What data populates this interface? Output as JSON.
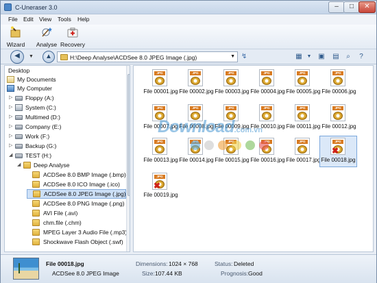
{
  "window": {
    "title": "C-Uneraser 3.0"
  },
  "menu": [
    "File",
    "Edit",
    "View",
    "Tools",
    "Help"
  ],
  "toolbar": {
    "wizard": "Wizard",
    "analyse": "Analyse",
    "recovery": "Recovery"
  },
  "address": {
    "path": "H:\\Deep Analyse\\ACDSee 8.0 JPEG Image (.jpg)"
  },
  "tree": {
    "items": [
      {
        "label": "Desktop",
        "icon": "desktop-icon"
      },
      {
        "label": "My Documents",
        "icon": "documents-icon"
      },
      {
        "label": "My Computer",
        "icon": "computer-icon"
      },
      {
        "label": "Floppy (A:)",
        "icon": "drive-icon"
      },
      {
        "label": "System (C:)",
        "icon": "system-drive-icon"
      },
      {
        "label": "Multimed (D:)",
        "icon": "drive-icon"
      },
      {
        "label": "Company (E:)",
        "icon": "drive-icon"
      },
      {
        "label": "Work (F:)",
        "icon": "drive-icon"
      },
      {
        "label": "Backup (G:)",
        "icon": "drive-icon"
      },
      {
        "label": "TEST (H:)",
        "icon": "drive-icon"
      },
      {
        "label": "Deep Analyse",
        "icon": "folder-icon"
      },
      {
        "label": "ACDSee 8.0 BMP Image (.bmp)",
        "icon": "folder-icon"
      },
      {
        "label": "ACDSee 8.0 ICO Image (.ico)",
        "icon": "folder-icon"
      },
      {
        "label": "ACDSee 8.0 JPEG Image (.jpg)",
        "icon": "folder-icon"
      },
      {
        "label": "ACDSee 8.0 PNG Image (.png)",
        "icon": "folder-icon"
      },
      {
        "label": "AVI File (.avi)",
        "icon": "folder-icon"
      },
      {
        "label": "chm.file (.chm)",
        "icon": "folder-icon"
      },
      {
        "label": "MPEG Layer 3 Audio File (.mp3)",
        "icon": "folder-icon"
      },
      {
        "label": "Shockwave Flash Object (.swf)",
        "icon": "folder-icon"
      }
    ]
  },
  "files": {
    "tag": "JPG",
    "items": [
      "File 00001.jpg",
      "File 00002.jpg",
      "File 00003.jpg",
      "File 00004.jpg",
      "File 00005.jpg",
      "File 00006.jpg",
      "File 00007.jpg",
      "File 00008.jpg",
      "File 00009.jpg",
      "File 00010.jpg",
      "File 00011.jpg",
      "File 00012.jpg",
      "File 00013.jpg",
      "File 00014.jpg",
      "File 00015.jpg",
      "File 00016.jpg",
      "File 00017.jpg",
      "File 00018.jpg",
      "File 00019.jpg"
    ]
  },
  "watermark": {
    "text": "Download",
    "domain": ".com.vn"
  },
  "status": {
    "filename": "File 00018.jpg",
    "filetype": "ACDSee 8.0 JPEG Image",
    "dimensions_label": "Dimensions:",
    "dimensions_value": "1024 × 768",
    "size_label": "Size:",
    "size_value": "107.44 KB",
    "status_label": "Status:",
    "status_value": "Deleted",
    "prognosis_label": "Prognosis:",
    "prognosis_value": "Good"
  },
  "colors": {
    "accent": "#4a86c8",
    "selection": "#cde0f7",
    "deleted_mark": "#d0201a"
  }
}
